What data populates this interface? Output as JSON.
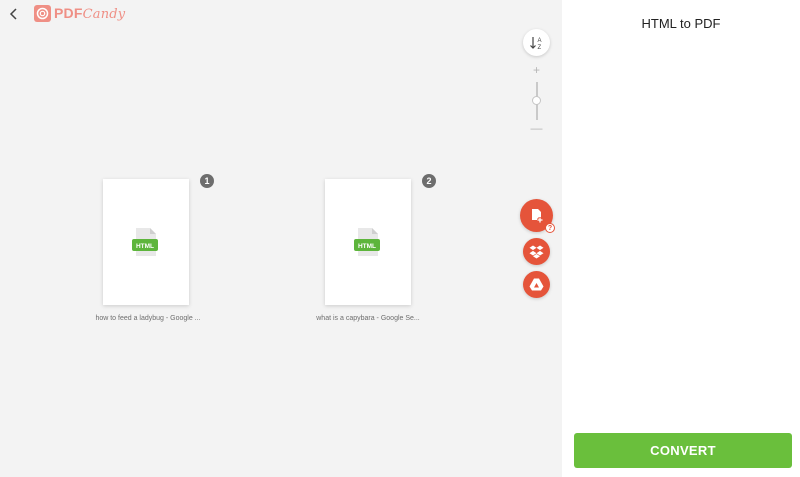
{
  "header": {
    "back_icon": "chevron-left-icon",
    "logo": {
      "part1": "PDF",
      "part2": "Candy",
      "color": "#ef8f85"
    }
  },
  "toolbar": {
    "sort_icon": "sort-az-icon",
    "zoom_plus": "+",
    "zoom_minus": "—"
  },
  "files": [
    {
      "index": "1",
      "name": "how to feed a ladybug - Google ...",
      "type_label": "HTML"
    },
    {
      "index": "2",
      "name": "what is a capybara - Google Se...",
      "type_label": "HTML"
    }
  ],
  "actions": {
    "add_file_icon": "add-file-icon",
    "help_mark": "?",
    "dropbox_icon": "dropbox-icon",
    "gdrive_icon": "google-drive-icon",
    "accent_color": "#e5543a"
  },
  "sidebar": {
    "title": "HTML to PDF",
    "convert_label": "CONVERT",
    "convert_color": "#6abf3c"
  }
}
